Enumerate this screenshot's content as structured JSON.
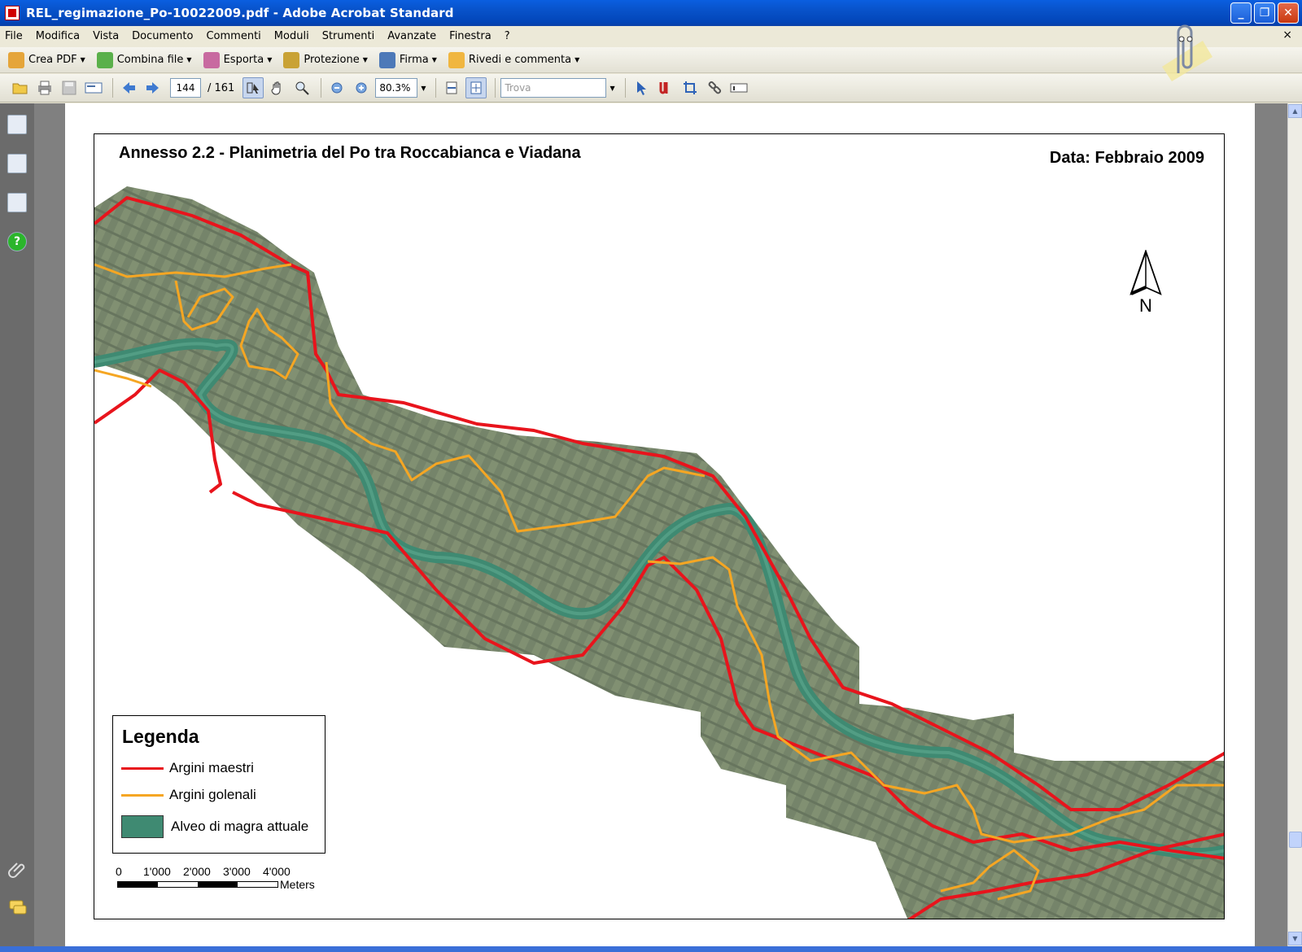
{
  "window": {
    "title": "REL_regimazione_Po-10022009.pdf - Adobe Acrobat Standard",
    "minimize": "_",
    "maximize": "❐",
    "close": "✕"
  },
  "menu": {
    "items": [
      "File",
      "Modifica",
      "Vista",
      "Documento",
      "Commenti",
      "Moduli",
      "Strumenti",
      "Avanzate",
      "Finestra",
      "?"
    ],
    "close_glyph": "×"
  },
  "tasks": [
    {
      "label": "Crea PDF",
      "icon": "create-pdf-icon",
      "color": "#e5a53a"
    },
    {
      "label": "Combina file",
      "icon": "combine-files-icon",
      "color": "#5ab04a"
    },
    {
      "label": "Esporta",
      "icon": "export-icon",
      "color": "#c86aa0"
    },
    {
      "label": "Protezione",
      "icon": "lock-icon",
      "color": "#c9a235"
    },
    {
      "label": "Firma",
      "icon": "pen-icon",
      "color": "#4d79b8"
    },
    {
      "label": "Rivedi e commenta",
      "icon": "comment-icon",
      "color": "#f0b640"
    }
  ],
  "nav": {
    "page_current": "144",
    "page_total": "/ 161",
    "zoom": "80.3%",
    "find_placeholder": "Trova"
  },
  "map": {
    "title": "Annesso 2.2 - Planimetria del Po tra Roccabianca e Viadana",
    "date": "Data: Febbraio 2009",
    "north": "N",
    "legend": {
      "title": "Legenda",
      "items": [
        {
          "label": "Argini maestri",
          "color": "#e8141c"
        },
        {
          "label": "Argini golenali",
          "color": "#f5a623"
        },
        {
          "label": "Alveo di magra attuale",
          "color": "#3f8a72"
        }
      ]
    },
    "scale": {
      "ticks": [
        "0",
        "1'000",
        "2'000",
        "3'000",
        "4'000"
      ],
      "unit": "Meters"
    },
    "colors": {
      "terrain": "#6f7f63",
      "river": "#3f8a72"
    }
  }
}
